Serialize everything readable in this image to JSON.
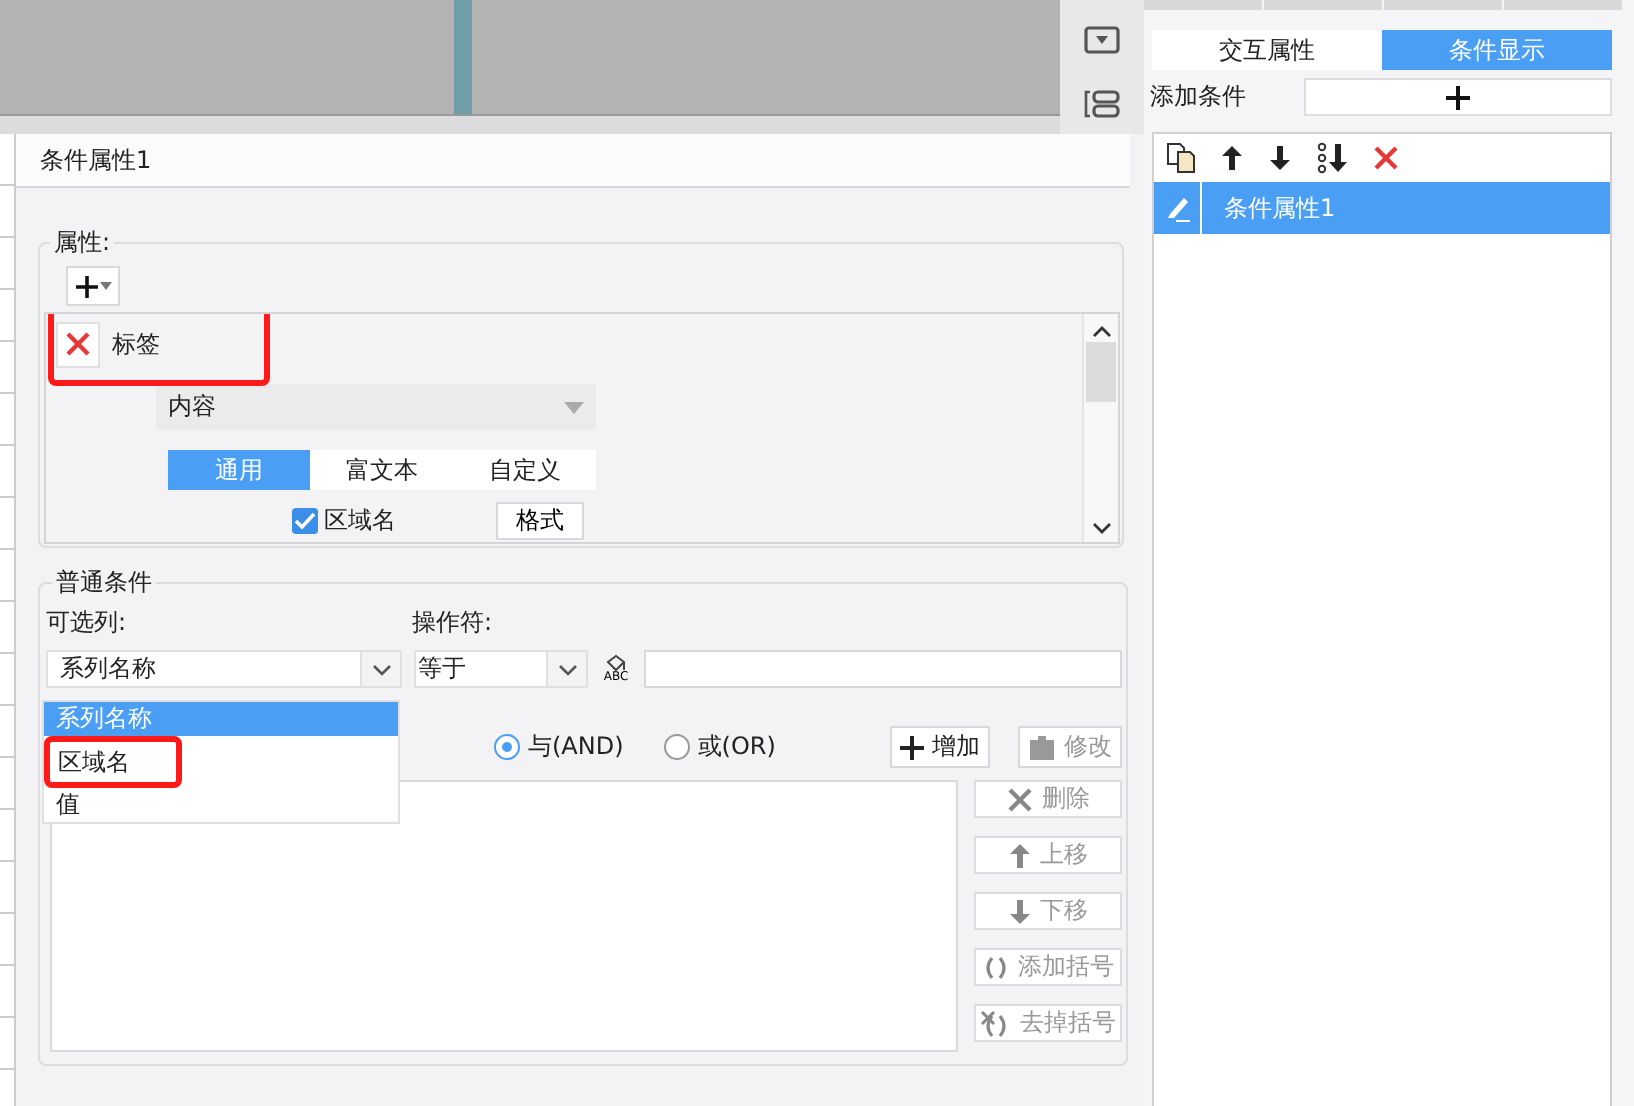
{
  "right_panel": {
    "tabs": [
      {
        "label": "交互属性",
        "selected": false
      },
      {
        "label": "条件显示",
        "selected": true
      }
    ],
    "add_condition_label": "添加条件",
    "conditions": [
      {
        "label": "条件属性1",
        "selected": true
      }
    ]
  },
  "dialog": {
    "title": "条件属性1",
    "attributes": {
      "legend": "属性:",
      "items": [
        {
          "name": "标签",
          "highlighted": true,
          "content_select": "内容",
          "format_tabs": [
            {
              "label": "通用",
              "selected": true
            },
            {
              "label": "富文本",
              "selected": false
            },
            {
              "label": "自定义",
              "selected": false
            }
          ],
          "area_name": {
            "label": "区域名",
            "checked": true
          },
          "format_button": "格式"
        }
      ]
    },
    "conditions": {
      "legend": "普通条件",
      "column_label": "可选列:",
      "operator_label": "操作符:",
      "column_select": "系列名称",
      "column_options": [
        {
          "label": "系列名称",
          "selected": true,
          "highlighted": false
        },
        {
          "label": "区域名",
          "selected": false,
          "highlighted": true
        },
        {
          "label": "值",
          "selected": false,
          "highlighted": false
        }
      ],
      "operator_select": "等于",
      "format_button": "ABC",
      "logic": [
        {
          "label": "与(AND)",
          "selected": true
        },
        {
          "label": "或(OR)",
          "selected": false
        }
      ],
      "add_button": {
        "label": "增加",
        "disabled": false
      },
      "modify_button": {
        "label": "修改",
        "disabled": true
      },
      "side_buttons": [
        {
          "kind": "delete",
          "label": "删除",
          "disabled": true
        },
        {
          "kind": "up",
          "label": "上移",
          "disabled": true
        },
        {
          "kind": "down",
          "label": "下移",
          "disabled": true
        },
        {
          "kind": "add-brackets",
          "label": "添加括号",
          "disabled": true
        },
        {
          "kind": "remove-brackets",
          "label": "去掉括号",
          "disabled": true
        }
      ]
    }
  }
}
